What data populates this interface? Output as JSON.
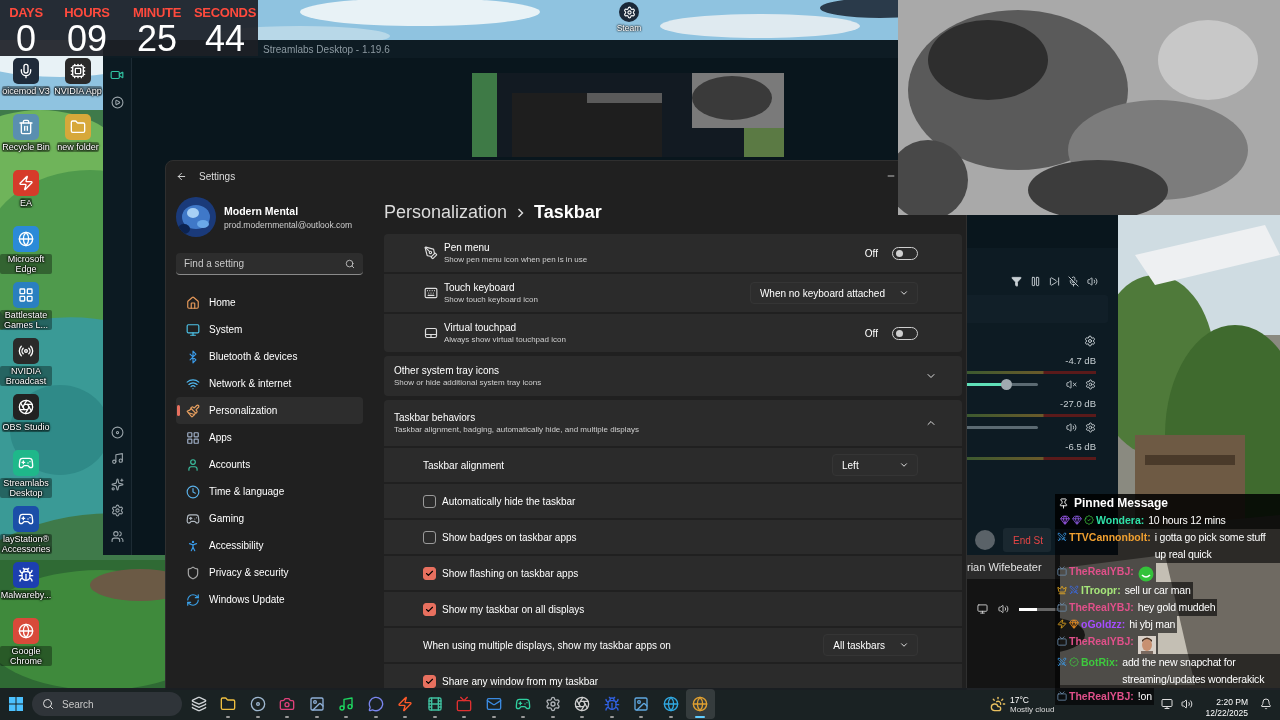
{
  "countdown": [
    {
      "label": "DAYS",
      "value": "0"
    },
    {
      "label": "HOURS",
      "value": "09"
    },
    {
      "label": "MINUTE",
      "value": "25"
    },
    {
      "label": "SECONDS",
      "value": "44"
    }
  ],
  "steam_icon": {
    "label": "Steam"
  },
  "desktop_icons": [
    {
      "label": "oicemod V3"
    },
    {
      "label": "NVIDIA App"
    },
    {
      "label": "Recycle Bin"
    },
    {
      "label": "new folder"
    },
    {
      "label": "EA"
    },
    {
      "label": "Microsoft Edge"
    },
    {
      "label": "Battlestate Games L..."
    },
    {
      "label": "NVIDIA Broadcast"
    },
    {
      "label": "OBS Studio"
    },
    {
      "label": "Streamlabs Desktop"
    },
    {
      "label": "layStation® Accessories"
    },
    {
      "label": "Malwareby..."
    },
    {
      "label": "Google Chrome"
    }
  ],
  "streamlabs": {
    "title": "Streamlabs Desktop - 1.19.6",
    "channels": [
      {
        "reading": "-4.7 dB",
        "muted": true,
        "level": 0.57
      },
      {
        "reading": "-27.0 dB",
        "muted": false
      },
      {
        "reading": "-6.5 dB"
      }
    ],
    "end_button": "End St"
  },
  "media": {
    "title": "rian Wifebeater",
    "volume": {
      "level": 0.45
    }
  },
  "settings": {
    "title": "Settings",
    "account": {
      "name": "Modern Mental",
      "email": "prod.modernmental@outlook.com"
    },
    "search": {
      "placeholder": "Find a setting"
    },
    "nav": [
      {
        "label": "Home",
        "selected": false
      },
      {
        "label": "System",
        "selected": false
      },
      {
        "label": "Bluetooth & devices",
        "selected": false
      },
      {
        "label": "Network & internet",
        "selected": false
      },
      {
        "label": "Personalization",
        "selected": true
      },
      {
        "label": "Apps",
        "selected": false
      },
      {
        "label": "Accounts",
        "selected": false
      },
      {
        "label": "Time & language",
        "selected": false
      },
      {
        "label": "Gaming",
        "selected": false
      },
      {
        "label": "Accessibility",
        "selected": false
      },
      {
        "label": "Privacy & security",
        "selected": false
      },
      {
        "label": "Windows Update",
        "selected": false
      }
    ],
    "breadcrumb": {
      "parent": "Personalization",
      "current": "Taskbar"
    },
    "groups": [
      {
        "kind": "list",
        "rows": [
          {
            "kind": "toggle",
            "title": "Pen menu",
            "subtitle": "Show pen menu icon when pen is in use",
            "on": false,
            "state_label": "Off"
          },
          {
            "kind": "dropdown",
            "title": "Touch keyboard",
            "subtitle": "Show touch keyboard icon",
            "value": "When no keyboard attached"
          },
          {
            "kind": "toggle",
            "title": "Virtual touchpad",
            "subtitle": "Always show virtual touchpad icon",
            "on": false,
            "state_label": "Off"
          }
        ]
      },
      {
        "kind": "expander",
        "title": "Other system tray icons",
        "subtitle": "Show or hide additional system tray icons",
        "expanded": false
      },
      {
        "kind": "expander",
        "title": "Taskbar behaviors",
        "subtitle": "Taskbar alignment, badging, automatically hide, and multiple displays",
        "expanded": true,
        "rows": [
          {
            "kind": "dropdown",
            "title": "Taskbar alignment",
            "value": "Left"
          },
          {
            "kind": "checkbox",
            "title": "Automatically hide the taskbar",
            "checked": false
          },
          {
            "kind": "checkbox",
            "title": "Show badges on taskbar apps",
            "checked": false
          },
          {
            "kind": "checkbox",
            "title": "Show flashing on taskbar apps",
            "checked": true
          },
          {
            "kind": "checkbox",
            "title": "Show my taskbar on all displays",
            "checked": true
          },
          {
            "kind": "dropdown",
            "title": "When using multiple displays, show my taskbar apps on",
            "value": "All taskbars"
          },
          {
            "kind": "checkbox",
            "title": "Share any window from my taskbar",
            "checked": true
          }
        ]
      }
    ]
  },
  "chat": {
    "pinned": {
      "label": "Pinned Message",
      "message": {
        "kind": "text",
        "user": "Wondera:",
        "color": "#2fe0a8",
        "text": "10 hours 12 mins"
      }
    },
    "messages": [
      {
        "kind": "text",
        "user": "TTVCannonbolt:",
        "color": "#f0a030",
        "text": "i gotta go pick some stuff up real quick"
      },
      {
        "kind": "smiley",
        "user": "TheRealYBJ:",
        "color": "#e0508a"
      },
      {
        "kind": "text",
        "user": "ITroopr:",
        "color": "#a6e67a",
        "text": "sell ur car man"
      },
      {
        "kind": "text",
        "user": "TheRealYBJ:",
        "color": "#e0508a",
        "text": "hey gold muddeh"
      },
      {
        "kind": "text",
        "user": "oGoldzz:",
        "color": "#a64dff",
        "text": "hi ybj man"
      },
      {
        "kind": "face",
        "user": "TheRealYBJ:",
        "color": "#e0508a"
      },
      {
        "kind": "text",
        "user": "BotRix:",
        "color": "#3ec93e",
        "text": "add the new snapchat for streaming/updates wonderakick"
      },
      {
        "kind": "text",
        "user": "TheRealYBJ:",
        "color": "#e0508a",
        "text": "!on"
      }
    ]
  },
  "taskbar": {
    "search": {
      "placeholder": "Search"
    },
    "apps": [
      {
        "running": false,
        "selected": false
      },
      {
        "running": true,
        "selected": false
      },
      {
        "running": true,
        "selected": false
      },
      {
        "running": true,
        "selected": false
      },
      {
        "running": true,
        "selected": false
      },
      {
        "running": true,
        "selected": false
      },
      {
        "running": true,
        "selected": false
      },
      {
        "running": true,
        "selected": false
      },
      {
        "running": true,
        "selected": false
      },
      {
        "running": true,
        "selected": false
      },
      {
        "running": true,
        "selected": false
      },
      {
        "running": true,
        "selected": false
      },
      {
        "running": true,
        "selected": false
      },
      {
        "running": true,
        "selected": false
      },
      {
        "running": true,
        "selected": false
      },
      {
        "running": true,
        "selected": false
      },
      {
        "running": true,
        "selected": false
      },
      {
        "running": true,
        "selected": true
      }
    ],
    "weather": {
      "temperature": "17°C",
      "condition": "Mostly cloud"
    },
    "clock": {
      "time": "2:20 PM",
      "date": "12/22/2025"
    }
  }
}
